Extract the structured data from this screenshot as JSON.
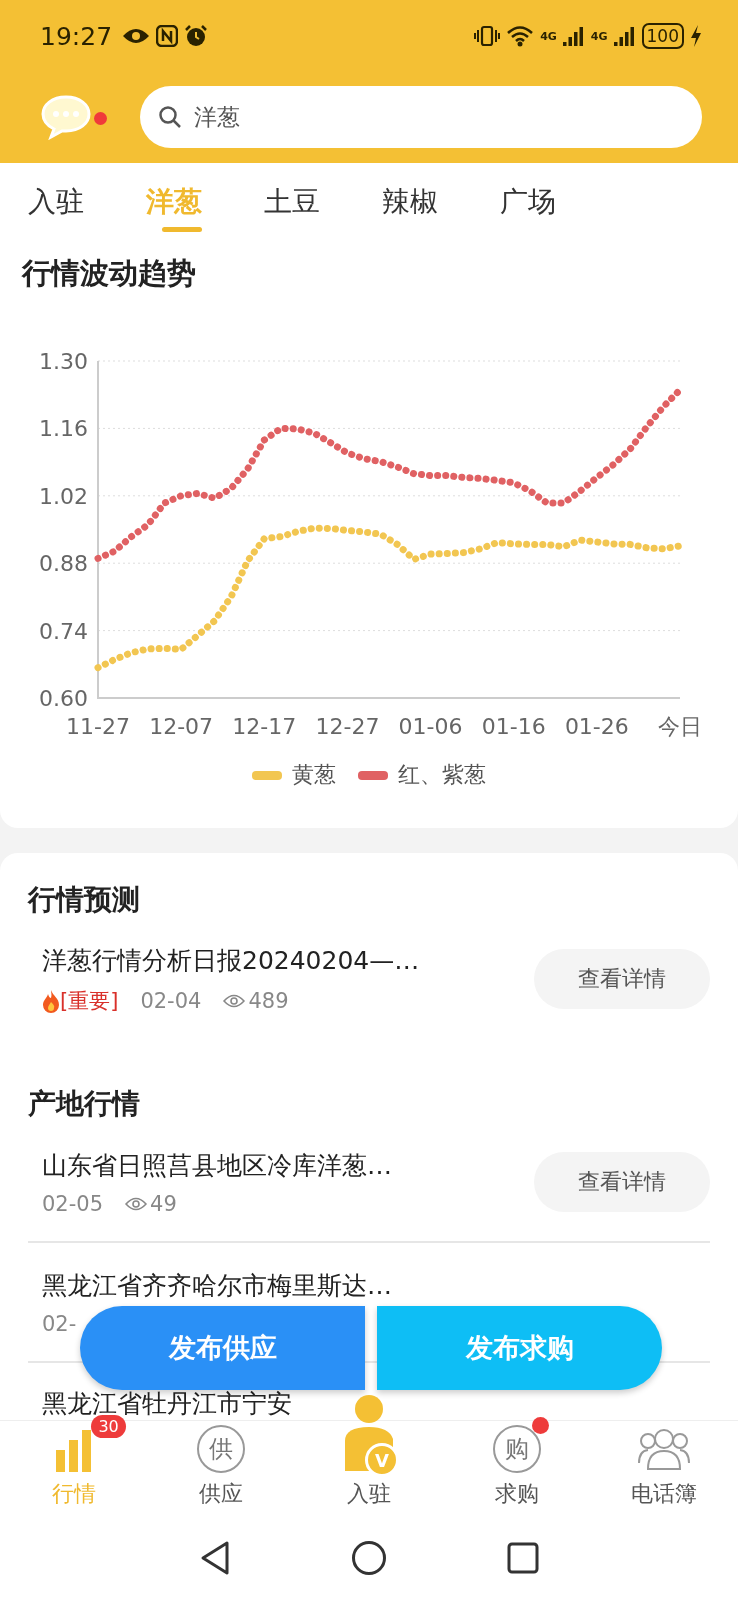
{
  "status_bar": {
    "time": "19:27",
    "network": [
      "4G",
      "4G"
    ],
    "battery": "100",
    "charging": true
  },
  "header": {
    "messages_unread": true,
    "search": {
      "value": "洋葱"
    }
  },
  "tabs": [
    {
      "label": "入驻",
      "selected": false
    },
    {
      "label": "洋葱",
      "selected": true
    },
    {
      "label": "土豆",
      "selected": false
    },
    {
      "label": "辣椒",
      "selected": false
    },
    {
      "label": "广场",
      "selected": false
    }
  ],
  "trend": {
    "title": "行情波动趋势",
    "chart_data": {
      "type": "line",
      "categories": [
        "11-27",
        null,
        null,
        null,
        null,
        "12-07",
        null,
        null,
        null,
        null,
        "12-17",
        null,
        null,
        null,
        null,
        "12-27",
        null,
        null,
        null,
        null,
        "01-06",
        null,
        null,
        null,
        null,
        "01-16",
        null,
        null,
        null,
        null,
        "01-26",
        null,
        null,
        null,
        null,
        "今日"
      ],
      "yticks": [
        {
          "value": 0.6,
          "label": "0.60"
        },
        {
          "value": 0.74,
          "label": "0.74"
        },
        {
          "value": 0.88,
          "label": "0.88"
        },
        {
          "value": 1.02,
          "label": "1.02"
        },
        {
          "value": 1.16,
          "label": "1.16"
        },
        {
          "value": 1.3,
          "label": "1.30"
        }
      ],
      "ylim": [
        0.6,
        1.3
      ],
      "grid": true,
      "series": [
        {
          "name": "黄葱",
          "color": "#f2c651",
          "line_style": "dotted",
          "values": [
            0.663,
            0.68,
            0.694,
            0.702,
            0.703,
            0.701,
            0.73,
            0.76,
            0.81,
            0.885,
            0.931,
            0.935,
            0.946,
            0.953,
            0.952,
            0.948,
            0.945,
            0.94,
            0.919,
            0.888,
            0.899,
            0.9,
            0.902,
            0.91,
            0.923,
            0.92,
            0.919,
            0.919,
            0.914,
            0.928,
            0.924,
            0.92,
            0.919,
            0.912,
            0.91,
            0.916
          ]
        },
        {
          "name": "红、紫葱",
          "color": "#e06163",
          "line_style": "dotted",
          "values": [
            0.89,
            0.905,
            0.935,
            0.96,
            1.005,
            1.02,
            1.025,
            1.015,
            1.035,
            1.076,
            1.136,
            1.16,
            1.159,
            1.15,
            1.13,
            1.109,
            1.097,
            1.091,
            1.08,
            1.066,
            1.062,
            1.062,
            1.058,
            1.056,
            1.052,
            1.047,
            1.03,
            1.005,
            1.005,
            1.03,
            1.058,
            1.085,
            1.117,
            1.163,
            1.205,
            1.24
          ]
        }
      ]
    }
  },
  "forecast": {
    "title": "行情预测",
    "items": [
      {
        "title": "洋葱行情分析日报20240204—…",
        "hot": true,
        "tag": "[重要]",
        "date": "02-04",
        "views": "489",
        "button": "查看详情"
      }
    ]
  },
  "origin": {
    "title": "产地行情",
    "items": [
      {
        "title": "山东省日照莒县地区冷库洋葱…",
        "date": "02-05",
        "views": "49",
        "button": "查看详情"
      },
      {
        "title": "黑龙江省齐齐哈尔市梅里斯达…",
        "date": "02-"
      },
      {
        "title": "黑龙江省牡丹江市宁安"
      }
    ]
  },
  "actions": [
    {
      "label": "发布供应",
      "kind": "supply"
    },
    {
      "label": "发布求购",
      "kind": "demand"
    }
  ],
  "bottom_nav": [
    {
      "label": "行情",
      "kind": "chart",
      "selected": true,
      "badge": "30"
    },
    {
      "label": "供应",
      "kind": "medal",
      "glyph": "供",
      "selected": false
    },
    {
      "label": "入驻",
      "kind": "member",
      "glyph": "V",
      "selected": false
    },
    {
      "label": "求购",
      "kind": "medal",
      "glyph": "购",
      "selected": false,
      "dot": true
    },
    {
      "label": "电话簿",
      "kind": "people",
      "selected": false
    }
  ]
}
